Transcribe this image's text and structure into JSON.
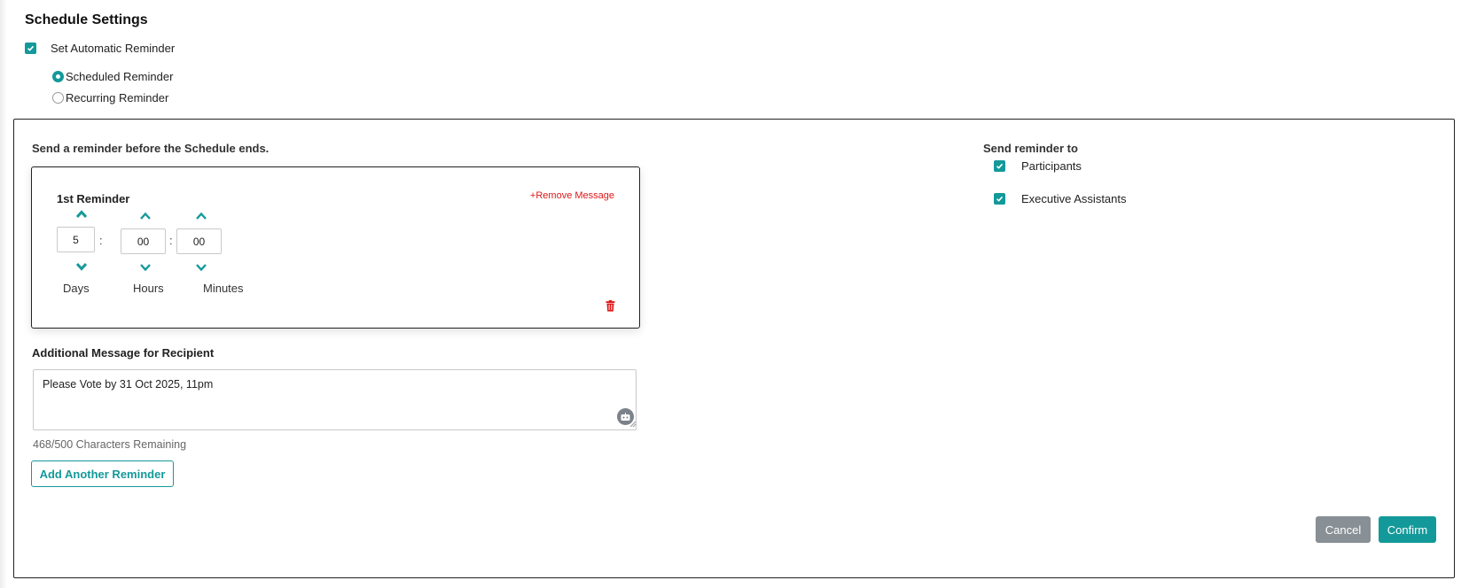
{
  "header": {
    "title": "Schedule Settings"
  },
  "auto_reminder": {
    "label": "Set Automatic Reminder",
    "checked": true
  },
  "reminder_type": {
    "options": [
      {
        "label": "Scheduled Reminder",
        "selected": true
      },
      {
        "label": "Recurring Reminder",
        "selected": false
      }
    ]
  },
  "panel": {
    "send_before_label": "Send a reminder before the Schedule ends.",
    "reminder": {
      "title": "1st Reminder",
      "remove_label": "+Remove Message",
      "days_value": "5",
      "hours_value": "00",
      "minutes_value": "00",
      "days_label": "Days",
      "hours_label": "Hours",
      "minutes_label": "Minutes",
      "separator": ":"
    },
    "message": {
      "label": "Additional Message for Recipient",
      "value": "Please Vote by 31 Oct 2025, 11pm",
      "chars_remaining": "468/500 Characters Remaining"
    },
    "add_reminder_label": "Add Another Reminder",
    "send_to": {
      "label": "Send reminder to",
      "recipients": [
        {
          "label": "Participants",
          "checked": true
        },
        {
          "label": "Executive Assistants",
          "checked": true
        }
      ]
    },
    "cancel_label": "Cancel",
    "confirm_label": "Confirm"
  },
  "colors": {
    "accent": "#14999a",
    "danger": "#e01616",
    "neutral_button": "#888f95"
  }
}
